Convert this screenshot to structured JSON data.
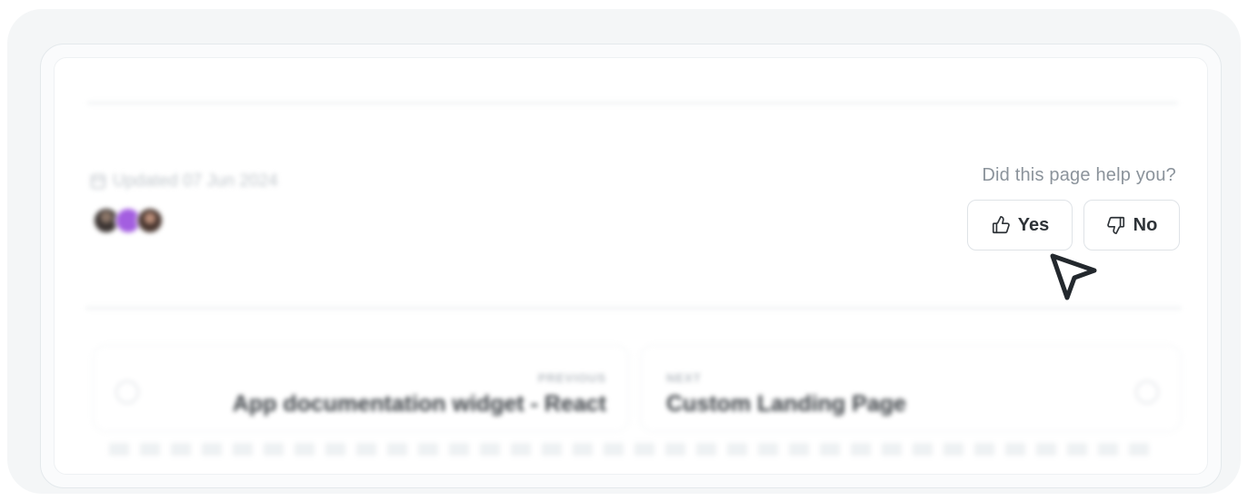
{
  "footer": {
    "updated_label": "Updated 07 Jun 2024",
    "feedback_question": "Did this page help you?",
    "yes_label": "Yes",
    "no_label": "No"
  },
  "pagination": {
    "previous_kicker": "PREVIOUS",
    "previous_title": "App documentation widget - React",
    "next_kicker": "NEXT",
    "next_title": "Custom Landing Page"
  },
  "icons": {
    "calendar": "calendar-icon",
    "thumbs_up": "thumbs-up-icon",
    "thumbs_down": "thumbs-down-icon",
    "cursor": "mouse-pointer-icon",
    "prev_arrow": "arrow-left-icon",
    "next_arrow": "arrow-right-icon"
  },
  "colors": {
    "contributor_avatar_accent": "#a35ee0",
    "button_text": "#2e3338",
    "muted_text": "#8b939b"
  }
}
